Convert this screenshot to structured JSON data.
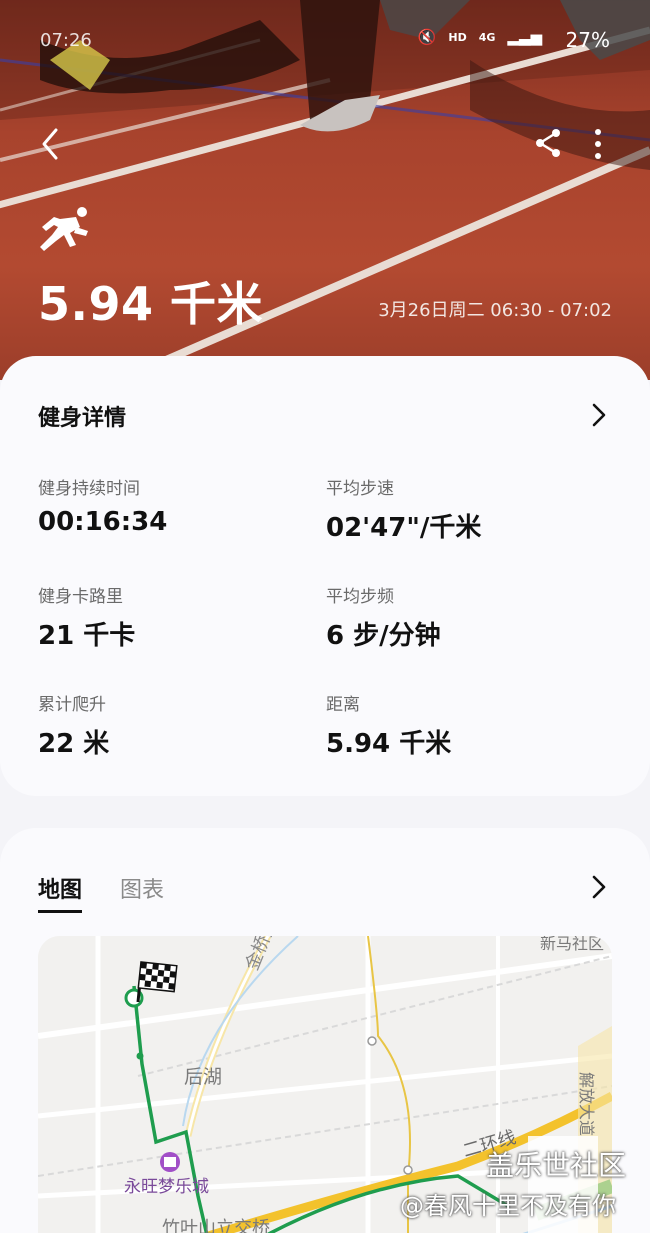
{
  "status_bar": {
    "left": "07:26",
    "network": "HD",
    "signal": "4G",
    "battery": "27%"
  },
  "hero": {
    "distance": "5.94 千米",
    "datetime": "3月26日周二 06:30 - 07:02"
  },
  "details": {
    "title": "健身详情",
    "stats": [
      {
        "label": "健身持续时间",
        "value": "00:16:34"
      },
      {
        "label": "平均步速",
        "value": "02'47\"/千米"
      },
      {
        "label": "健身卡路里",
        "value": "21 千卡"
      },
      {
        "label": "平均步频",
        "value": "6 步/分钟"
      },
      {
        "label": "累计爬升",
        "value": "22 米"
      },
      {
        "label": "距离",
        "value": "5.94 千米"
      }
    ]
  },
  "map_section": {
    "tabs": [
      "地图",
      "图表"
    ],
    "labels": {
      "road1": "金桥大道",
      "lake": "后湖",
      "mall": "永旺梦乐城",
      "ring": "二环线",
      "bridge": "竹叶山立交桥",
      "district": "新马社区",
      "avenue": "解放大道"
    }
  },
  "watermark": {
    "line1": "盖乐世社区",
    "line2": "@春风十里不及有你"
  },
  "colors": {
    "accent": "#1f9d4e",
    "road_yellow": "#f3c22c",
    "hero_red": "#a8432d"
  }
}
